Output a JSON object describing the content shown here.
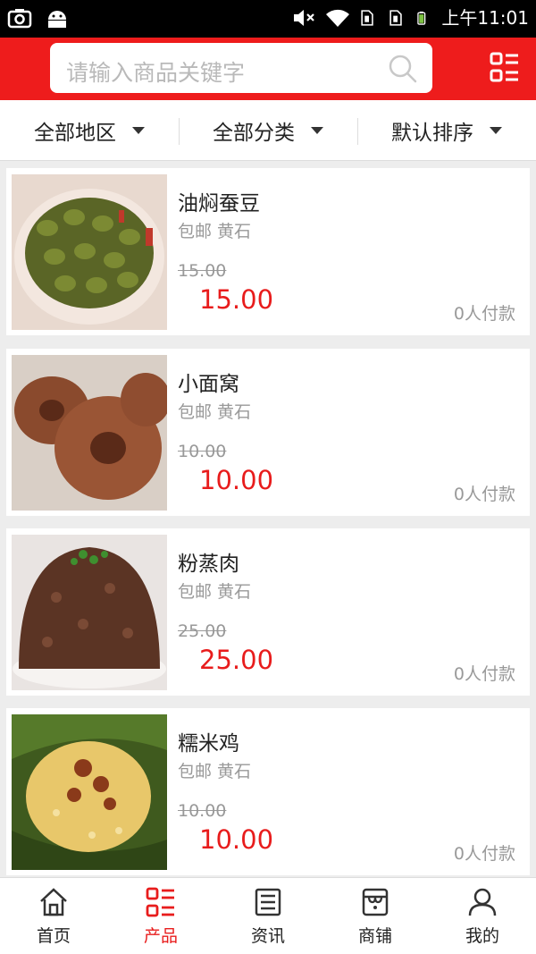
{
  "status_bar": {
    "time": "上午11:01",
    "icons": [
      "screenshot-icon",
      "android-icon",
      "mute-icon",
      "wifi-icon",
      "sim1-icon",
      "sim2-icon",
      "battery-icon"
    ]
  },
  "header": {
    "search_placeholder": "请输入商品关键字",
    "icons": [
      "search-icon",
      "menu-grid-icon"
    ],
    "accent_color": "#ee1c1c"
  },
  "filters": [
    {
      "label": "全部地区"
    },
    {
      "label": "全部分类"
    },
    {
      "label": "默认排序"
    }
  ],
  "products": [
    {
      "name": "油焖蚕豆",
      "tag": "包邮 黄石",
      "old_price": "15.00",
      "price": "15.00",
      "paid": "0人付款"
    },
    {
      "name": "小面窝",
      "tag": "包邮 黄石",
      "old_price": "10.00",
      "price": "10.00",
      "paid": "0人付款"
    },
    {
      "name": "粉蒸肉",
      "tag": "包邮 黄石",
      "old_price": "25.00",
      "price": "25.00",
      "paid": "0人付款"
    },
    {
      "name": "糯米鸡",
      "tag": "包邮 黄石",
      "old_price": "10.00",
      "price": "10.00",
      "paid": "0人付款"
    }
  ],
  "tabs": [
    {
      "label": "首页",
      "icon": "home-icon"
    },
    {
      "label": "产品",
      "icon": "product-list-icon",
      "active": true
    },
    {
      "label": "资讯",
      "icon": "news-icon"
    },
    {
      "label": "商铺",
      "icon": "shop-icon"
    },
    {
      "label": "我的",
      "icon": "user-icon"
    }
  ]
}
